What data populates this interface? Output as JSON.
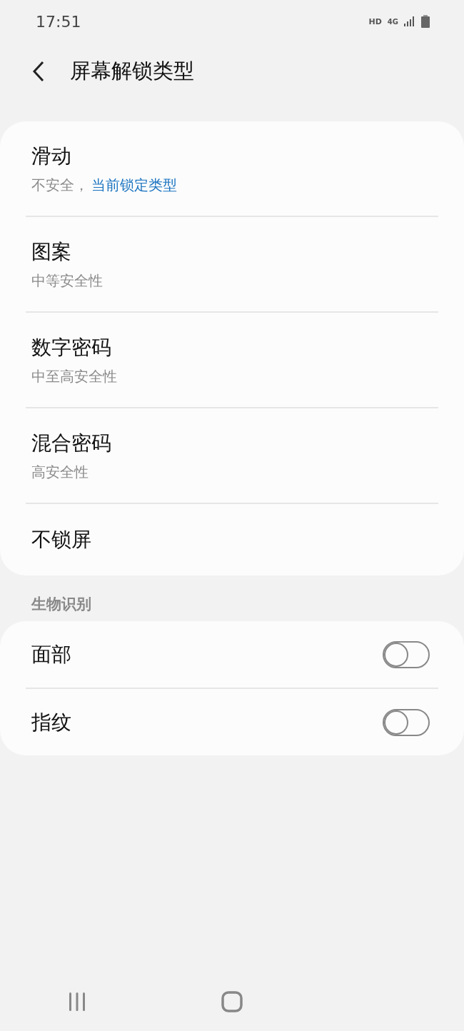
{
  "status_bar": {
    "time": "17:51",
    "hd": "HD",
    "network": "4G"
  },
  "header": {
    "title": "屏幕解锁类型"
  },
  "lock_types": [
    {
      "title": "滑动",
      "subtitle": "不安全，",
      "current_label": "当前锁定类型"
    },
    {
      "title": "图案",
      "subtitle": "中等安全性"
    },
    {
      "title": "数字密码",
      "subtitle": "中至高安全性"
    },
    {
      "title": "混合密码",
      "subtitle": "高安全性"
    },
    {
      "title": "不锁屏"
    }
  ],
  "biometrics": {
    "heading": "生物识别",
    "items": [
      {
        "label": "面部",
        "on": false
      },
      {
        "label": "指纹",
        "on": false
      }
    ]
  }
}
